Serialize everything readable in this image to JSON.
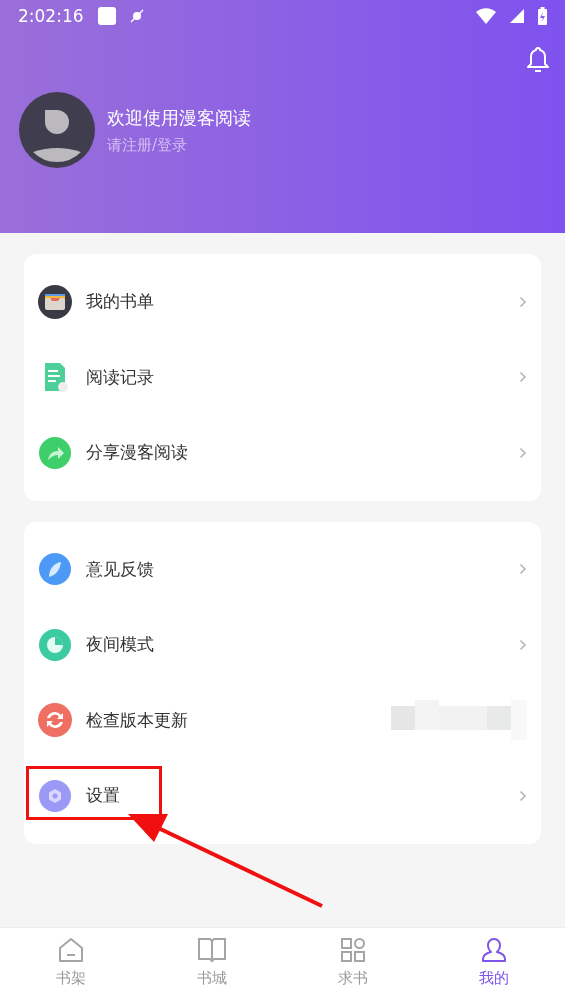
{
  "status_bar": {
    "time": "2:02:16"
  },
  "profile": {
    "title": "欢迎使用漫客阅读",
    "subtitle": "请注册/登录"
  },
  "menu_groups": [
    {
      "items": [
        {
          "label": "我的书单",
          "chevron": true,
          "redacted": false,
          "highlighted": false
        },
        {
          "label": "阅读记录",
          "chevron": true,
          "redacted": false,
          "highlighted": false
        },
        {
          "label": "分享漫客阅读",
          "chevron": true,
          "redacted": false,
          "highlighted": false
        }
      ]
    },
    {
      "items": [
        {
          "label": "意见反馈",
          "chevron": true,
          "redacted": false,
          "highlighted": false
        },
        {
          "label": "夜间模式",
          "chevron": true,
          "redacted": false,
          "highlighted": false
        },
        {
          "label": "检查版本更新",
          "chevron": false,
          "redacted": true,
          "highlighted": false
        },
        {
          "label": "设置",
          "chevron": true,
          "redacted": false,
          "highlighted": true
        }
      ]
    }
  ],
  "tab_bar": [
    {
      "label": "书架",
      "selected": false
    },
    {
      "label": "书城",
      "selected": false
    },
    {
      "label": "求书",
      "selected": false
    },
    {
      "label": "我的",
      "selected": true
    }
  ]
}
